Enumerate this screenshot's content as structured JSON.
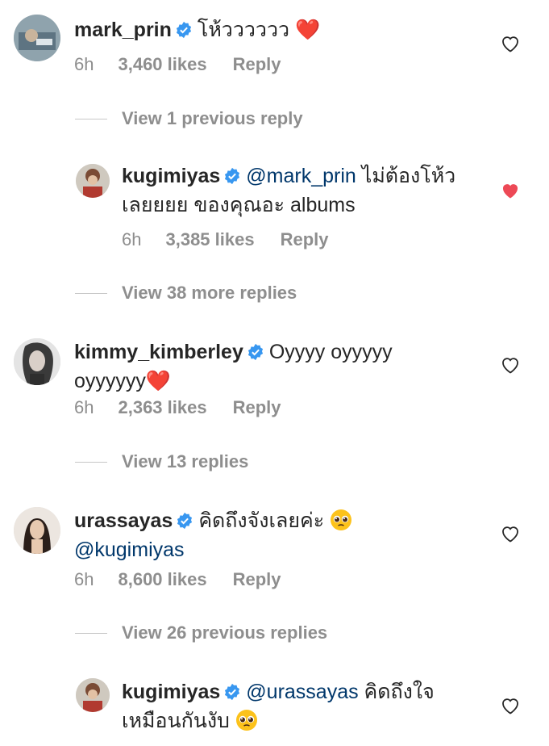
{
  "comments": [
    {
      "username": "mark_prin",
      "text": "โห้วววววว",
      "emoji": "❤️",
      "time": "6h",
      "likes": "3,460 likes",
      "reply": "Reply",
      "liked": false
    },
    {
      "username": "kugimiyas",
      "mention": "@mark_prin",
      "text_line1": " ไม่ต้องโห้ว",
      "text_line2": "เลยยยย ของคุณอะ albums",
      "time": "6h",
      "likes": "3,385 likes",
      "reply": "Reply",
      "liked": true
    },
    {
      "username": "kimmy_kimberley",
      "text_line1": "Oyyyy oyyyyy",
      "text_line2": "oyyyyyy",
      "emoji": "❤️",
      "time": "6h",
      "likes": "2,363 likes",
      "reply": "Reply",
      "liked": false
    },
    {
      "username": "urassayas",
      "text_line1": "คิดถึงจังเลยค่ะ",
      "mention": "@kugimiyas",
      "emoji_name": "pleading-face",
      "time": "6h",
      "likes": "8,600 likes",
      "reply": "Reply",
      "liked": false
    },
    {
      "username": "kugimiyas",
      "mention": "@urassayas",
      "text_line1": " คิดถึงใจ",
      "text_line2": "เหมือนกันงับ",
      "emoji_name": "pleading-face",
      "liked": false
    }
  ],
  "view_links": [
    "View 1 previous reply",
    "View 38 more replies",
    "View 13 replies",
    "View 26 previous replies"
  ],
  "colors": {
    "text": "#262626",
    "secondary": "#8e8e8e",
    "mention": "#00376b",
    "verified": "#3897f0",
    "liked_heart": "#ed4956"
  },
  "icons": [
    "verified-badge-icon",
    "heart-outline-icon",
    "heart-filled-icon",
    "pleading-face-emoji"
  ]
}
